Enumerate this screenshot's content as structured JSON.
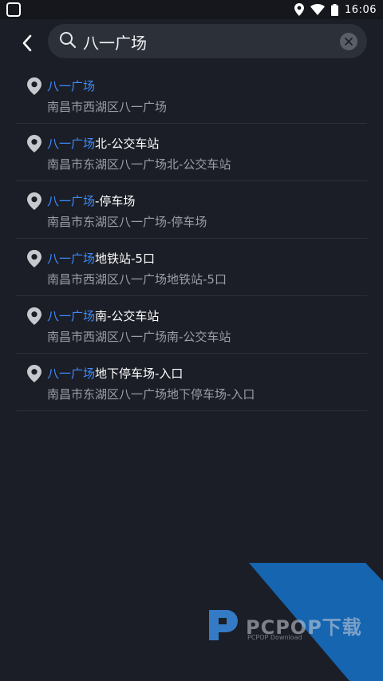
{
  "status_bar": {
    "time": "16:06"
  },
  "search": {
    "query": "八一广场"
  },
  "results": [
    {
      "highlight": "八一广场",
      "rest": "",
      "address": "南昌市西湖区八一广场"
    },
    {
      "highlight": "八一广场",
      "rest": "北-公交车站",
      "address": "南昌市东湖区八一广场北-公交车站"
    },
    {
      "highlight": "八一广场",
      "rest": "-停车场",
      "address": "南昌市东湖区八一广场-停车场"
    },
    {
      "highlight": "八一广场",
      "rest": "地铁站-5口",
      "address": "南昌市西湖区八一广场地铁站-5口"
    },
    {
      "highlight": "八一广场",
      "rest": "南-公交车站",
      "address": "南昌市西湖区八一广场南-公交车站"
    },
    {
      "highlight": "八一广场",
      "rest": "地下停车场-入口",
      "address": "南昌市东湖区八一广场地下停车场-入口"
    }
  ],
  "watermark": {
    "title": "PCPOP下载",
    "subtitle": "PCPOP Download"
  },
  "colors": {
    "background": "#1b1e26",
    "highlight": "#3d8bff",
    "search_box": "#2c3039"
  }
}
